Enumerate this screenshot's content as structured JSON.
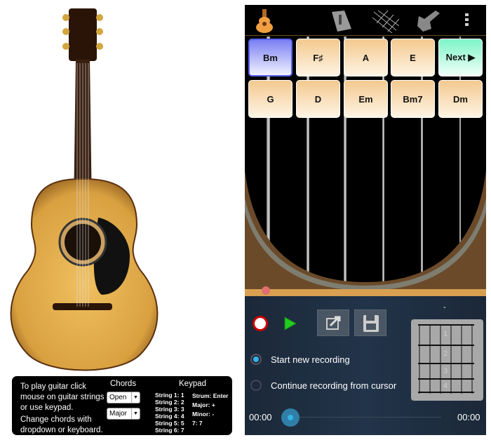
{
  "left": {
    "help": [
      "To play guitar click mouse on guitar strings or use keypad.",
      "Change chords with dropdown or keyboard."
    ],
    "chords_heading": "Chords",
    "chord_type_select": "Open",
    "chord_quality_select": "Major",
    "keypad_heading": "Keypad",
    "keypad_strings": [
      "String 1: 1",
      "String 2: 2",
      "String 3: 3",
      "String 4: 4",
      "String 5: 5",
      "String 6: 7"
    ],
    "keypad_other": [
      "Strum: Enter",
      "Major: +",
      "Minor: -",
      "7: 7"
    ]
  },
  "app": {
    "toolbar_icons": [
      "acoustic-guitar-icon",
      "songbook-icon",
      "fretboard-icon",
      "electric-guitar-icon",
      "more-vert-icon"
    ],
    "chord_buttons": [
      "Bm",
      "F♯",
      "A",
      "E",
      "Next ▶",
      "G",
      "D",
      "Em",
      "Bm7",
      "Dm"
    ],
    "selected_chord": "Bm",
    "recording": {
      "start_new": "Start new recording",
      "continue": "Continue recording from cursor",
      "selected_option": "Start new recording",
      "time_start": "00:00",
      "time_end": "00:00",
      "progress": 0
    },
    "chord_diagram": {
      "title": "-",
      "fret_numbers": [
        "1",
        "2",
        "3",
        "4"
      ]
    },
    "colors": {
      "record": "#cc0000",
      "play": "#22cc22",
      "accent": "#33b5e5"
    }
  }
}
